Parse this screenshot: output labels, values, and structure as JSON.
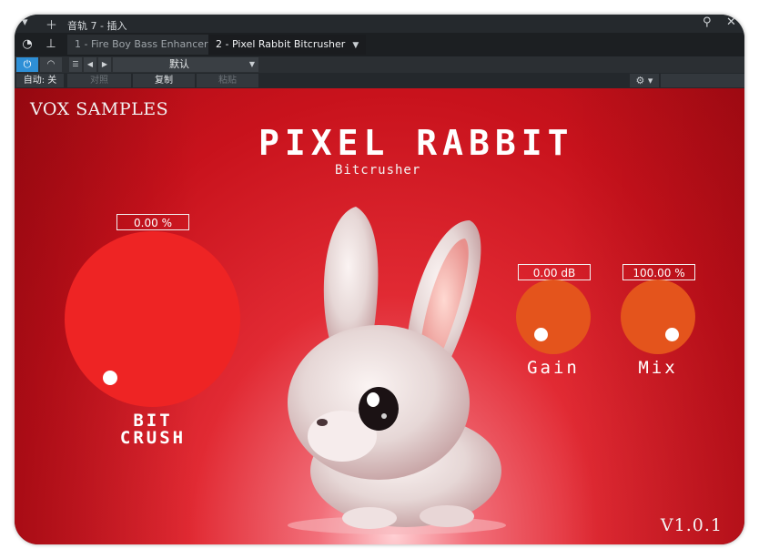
{
  "host": {
    "title": "音轨 7 - 插入",
    "tabs": [
      {
        "label": "1 - Fire Boy Bass Enhancer"
      },
      {
        "label": "2 - Pixel Rabbit Bitcrusher"
      }
    ],
    "preset_name": "默认",
    "auto_label": "自动: 关",
    "compare_label": "对照",
    "copy_label": "复制",
    "paste_label": "粘贴"
  },
  "plugin": {
    "brand": "VOX SAMPLES",
    "title": "PIXEL RABBIT",
    "subtitle": "Bitcrusher",
    "version": "V1.0.1",
    "controls": {
      "bitcrush": {
        "value_text": "0.00 %",
        "label_line1": "BIT",
        "label_line2": "CRUSH"
      },
      "gain": {
        "value_text": "0.00 dB",
        "label": "Gain"
      },
      "mix": {
        "value_text": "100.00 %",
        "label": "Mix"
      }
    }
  },
  "colors": {
    "bitcrush_knob": "#ee2424",
    "small_knobs": "#e4541c",
    "power_active": "#2e8fd6"
  },
  "icons": [
    "dropdown-arrow-icon",
    "plus-icon",
    "pin-icon",
    "close-icon",
    "clock-icon",
    "routing-icon",
    "power-icon",
    "meter-icon",
    "list-icon",
    "prev-icon",
    "next-icon",
    "gear-icon"
  ]
}
